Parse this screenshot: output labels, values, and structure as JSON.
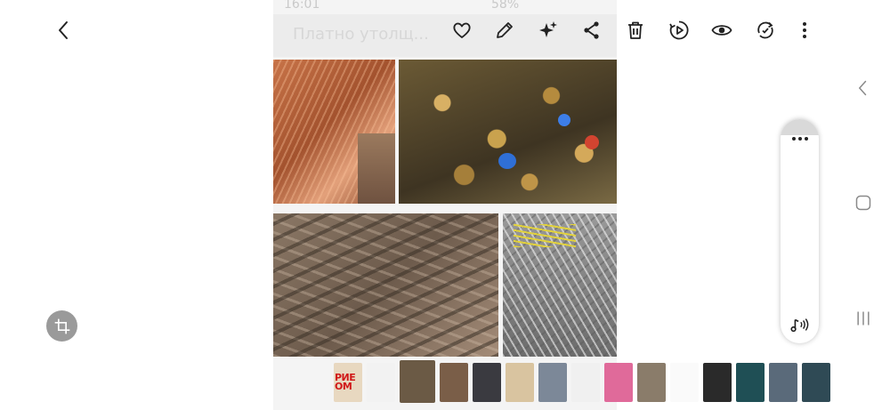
{
  "status_bar": {
    "time": "16:01",
    "battery": "58%"
  },
  "photo": {
    "header_ghost_text": "Платно утолщ..."
  },
  "toolbar": {
    "icons": [
      "back-icon",
      "heart-icon",
      "edit-icon",
      "sparkle-icon",
      "share-icon",
      "delete-icon",
      "video-icon",
      "visibility-icon",
      "rotate-icon",
      "more-icon"
    ]
  },
  "thumbnails": {
    "first_label_line1": "РИЕ",
    "first_label_line2": "ОМ",
    "colors": [
      "#e8d8c0",
      "#f2f2f2",
      "#6b5a45",
      "#7a5e48",
      "#3a3a40",
      "#d9c4a0",
      "#7c8898",
      "#f0f0f0",
      "#e06a9a",
      "#8a7c6a",
      "#fafafa",
      "#2a2a2a",
      "#1f4f55",
      "#5a6a7a",
      "#2f4a55"
    ]
  },
  "colors": {
    "icon": "#222222",
    "nav_icon": "#8a8a8a",
    "crop_bg": "#9a9a9a"
  }
}
